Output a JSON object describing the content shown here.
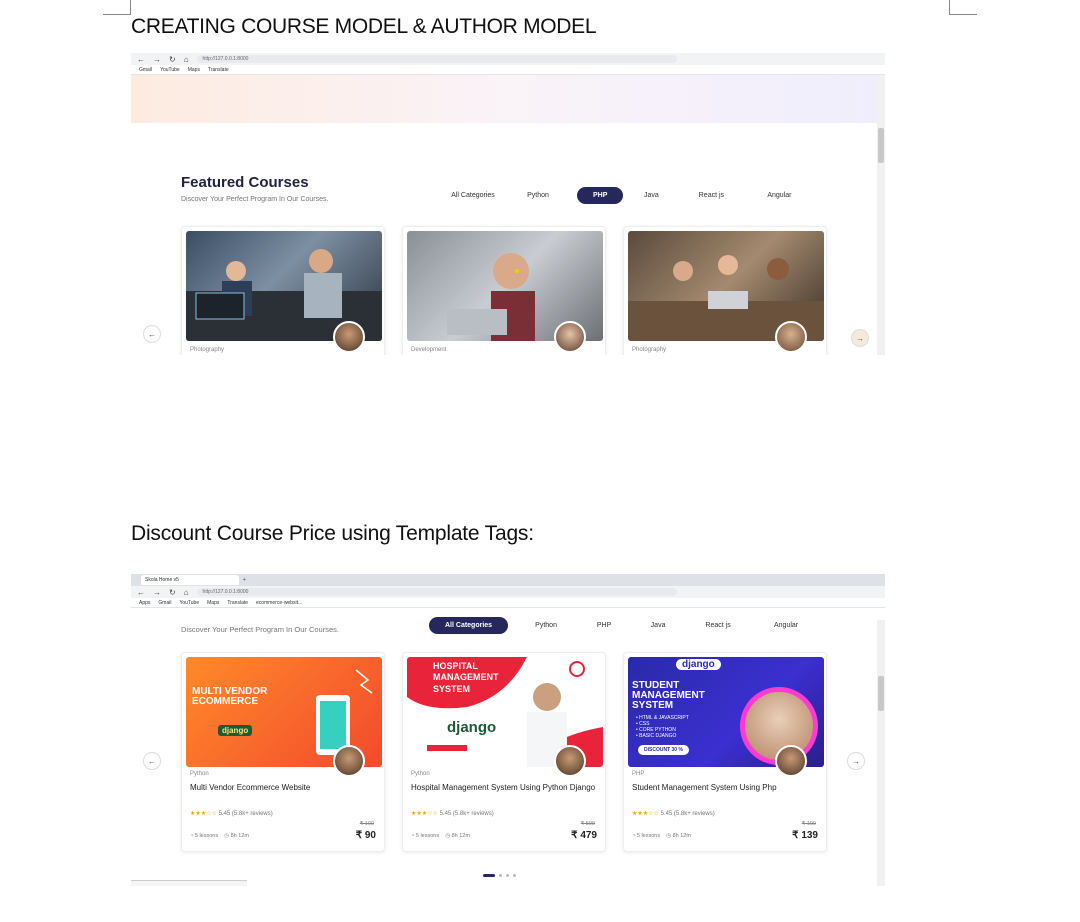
{
  "doc": {
    "heading1": "CREATING COURSE MODEL & AUTHOR MODEL",
    "heading2": "Discount Course Price using Template Tags:"
  },
  "browser1": {
    "url": "http://127.0.0.1:8000",
    "bookmarks": [
      "Gmail",
      "YouTube",
      "Maps",
      "Translate"
    ]
  },
  "browser2": {
    "tab_title": "Skola Home v5",
    "url": "http://127.0.0.1:8000",
    "bookmarks": [
      "Apps",
      "Gmail",
      "YouTube",
      "Maps",
      "Translate",
      "ecommerce-websit..."
    ]
  },
  "featured": {
    "title": "Featured Courses",
    "subtitle": "Discover Your Perfect Program In Our Courses.",
    "categories": [
      "All Categories",
      "Python",
      "PHP",
      "Java",
      "React js",
      "Angular"
    ],
    "active_category_1": "PHP",
    "active_category_2": "All Categories"
  },
  "cards1": [
    {
      "category": "Photography"
    },
    {
      "category": "Development"
    },
    {
      "category": "Photography"
    }
  ],
  "cards2": [
    {
      "category": "Python",
      "title": "Multi Vendor Ecommerce Website",
      "rating": "5.45 (5.8k+ reviews)",
      "lessons": "5 lessons",
      "duration": "8h 12m",
      "old_price": "₹ 100",
      "price": "₹ 90",
      "banner_lines": [
        "MULTI VENDOR",
        "ECOMMERCE"
      ],
      "banner_brand": "django"
    },
    {
      "category": "Python",
      "title": "Hospital Management System Using Python Django",
      "rating": "5.45 (5.8k+ reviews)",
      "lessons": "5 lessons",
      "duration": "8h 12m",
      "old_price": "₹ 599",
      "price": "₹ 479",
      "banner_lines": [
        "HOSPITAL",
        "MANAGEMENT",
        "SYSTEM"
      ],
      "banner_brand": "django"
    },
    {
      "category": "PHP",
      "title": "Student Management System Using Php",
      "rating": "5.45 (5.8k+ reviews)",
      "lessons": "5 lessons",
      "duration": "8h 12m",
      "old_price": "₹ 199",
      "price": "₹ 139",
      "banner_lines": [
        "STUDENT",
        "MANAGEMENT",
        "SYSTEM"
      ],
      "banner_brand": "django",
      "banner_list": [
        "HTML & JAVASCRIPT",
        "CSS",
        "CORE PYTHON",
        "BASIC DJANGO"
      ],
      "banner_discount": "DISCOUNT 30 %"
    }
  ],
  "colors": {
    "accent": "#26285c",
    "star": "#f0a500"
  }
}
